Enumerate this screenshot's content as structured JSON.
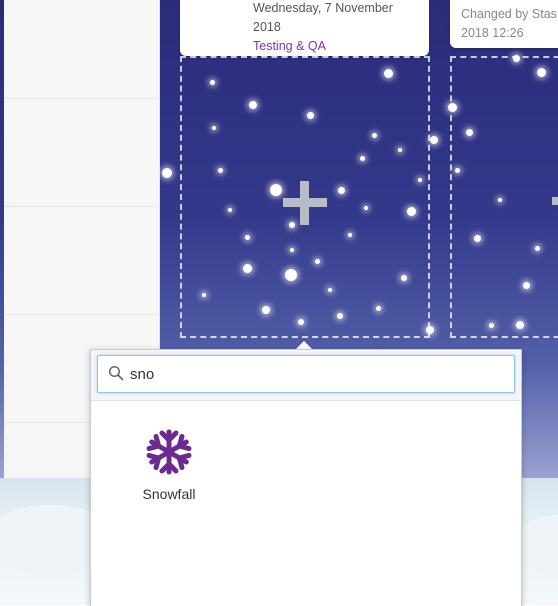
{
  "cards": [
    {
      "date_line1": "Wednesday, 7 November",
      "date_line2": "2018",
      "tag": "Testing & QA"
    },
    {
      "changed_by": "Changed by Stas",
      "date": "2018 12:26"
    }
  ],
  "popup": {
    "search": {
      "value": "sno",
      "placeholder": ""
    },
    "results": [
      {
        "label": "Snowfall",
        "icon": "snowflake-icon",
        "color": "#6b2a8f"
      }
    ]
  },
  "colors": {
    "accent_purple": "#7b35a8",
    "search_border": "#8fc6e8",
    "board_top": "#2a2c7a"
  }
}
